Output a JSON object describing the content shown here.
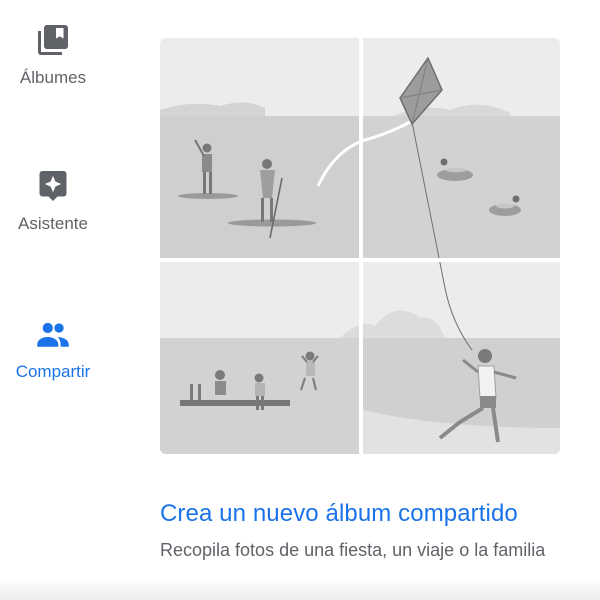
{
  "nav": {
    "items": [
      {
        "label": "Álbumes",
        "icon": "photo-album-icon",
        "active": false
      },
      {
        "label": "Asistente",
        "icon": "assistant-sparkle-icon",
        "active": false
      },
      {
        "label": "Compartir",
        "icon": "people-share-icon",
        "active": true
      }
    ]
  },
  "card": {
    "title": "Crea un nuevo álbum compartido",
    "subtitle": "Recopila fotos de una fiesta, un viaje o la familia"
  },
  "colors": {
    "accent": "#1a73e8",
    "icon_inactive": "#5f6368",
    "text_secondary": "#5f6368",
    "illustration_bg": "#ebebeb"
  }
}
